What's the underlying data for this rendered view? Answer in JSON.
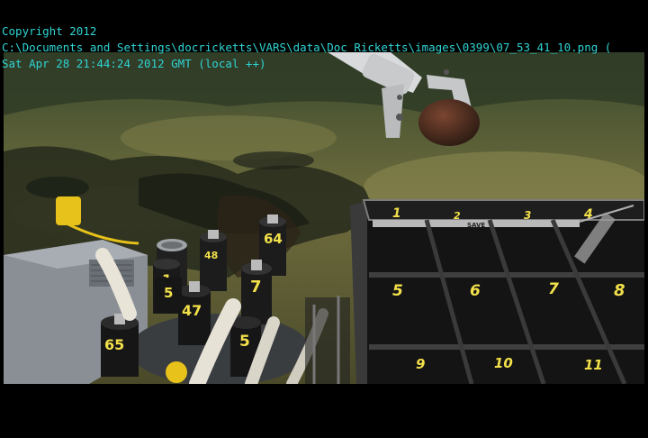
{
  "overlay": {
    "copyright": "Copyright 2012",
    "path": "C:\\Documents and Settings\\docricketts\\VARS\\data\\Doc Ricketts\\images\\0399\\07_53_41_10.png (",
    "timestamp": "Sat Apr 28 21:44:24 2012 GMT (local ++)"
  },
  "crate": {
    "label": "SAVE",
    "cells": [
      "1",
      "2",
      "3",
      "4",
      "5",
      "6",
      "7",
      "8",
      "9",
      "10",
      "11"
    ]
  },
  "tubes": [
    "5",
    "65",
    "47",
    "1",
    "48",
    "64",
    "5",
    "7"
  ],
  "colors": {
    "overlay_text": "#2fd3d3",
    "crate_numbers": "#f2e04a",
    "seafloor": "#6b6a3a",
    "background": "#000000"
  }
}
